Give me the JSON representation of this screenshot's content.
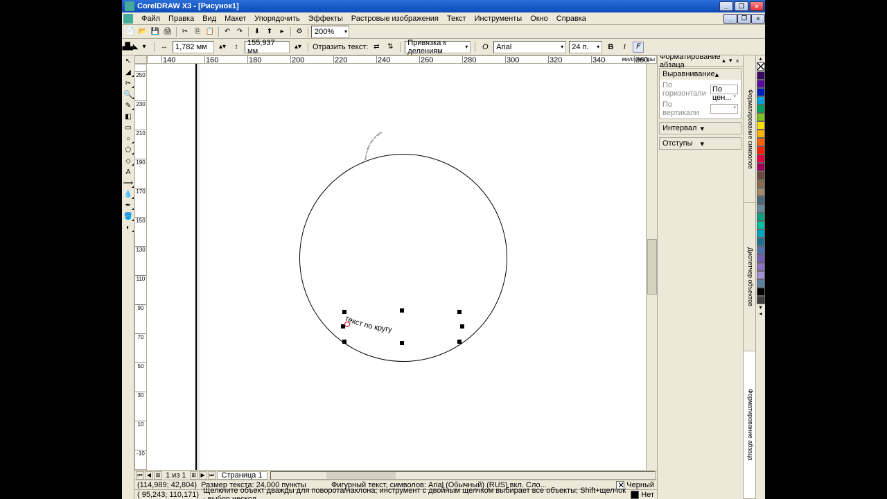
{
  "title": "CorelDRAW X3 - [Рисунок1]",
  "menus": [
    "Файл",
    "Правка",
    "Вид",
    "Макет",
    "Упорядочить",
    "Эффекты",
    "Растровые изображения",
    "Текст",
    "Инструменты",
    "Окно",
    "Справка"
  ],
  "zoom": "200%",
  "propbar": {
    "dist1": "1,782 мм",
    "dist2": "155,937 мм",
    "mirror": "Отразить текст:",
    "snap": "Привязка к делениям",
    "font": "Arial",
    "size": "24 п."
  },
  "ruler_units": "миллиметры",
  "ruler_h": [
    140,
    160,
    180,
    200,
    220,
    240,
    260,
    280,
    300,
    320,
    340,
    360
  ],
  "ruler_v_start": 250,
  "ruler_v_step": 20,
  "docker": {
    "title": "Форматирование абзаца",
    "sections": {
      "align": "Выравнивание",
      "horiz": "По горизонтали",
      "horiz_val": "По цен...",
      "vert": "По вертикали",
      "interval": "Интервал",
      "indents": "Отступы"
    }
  },
  "docker_tabs": [
    "Форматирование символов",
    "Диспетчер объектов",
    "Форматирование абзаца"
  ],
  "palette_colors": [
    "#3a0a5e",
    "#5a0a9e",
    "#0020c0",
    "#00a0e0",
    "#00a060",
    "#80c020",
    "#ffe000",
    "#ffb000",
    "#ff6000",
    "#ff2000",
    "#e00040",
    "#a0005a",
    "#6a4a3a",
    "#8a6a4a",
    "#a08a6a",
    "#4a6a7a",
    "#6a8a9a",
    "#0aa080",
    "#00c0a0",
    "#00a0c0",
    "#207090",
    "#5070b0",
    "#7060b0",
    "#9070c0",
    "#a090d0",
    "#6080a0",
    "#000000",
    "#404040"
  ],
  "page_nav": {
    "counter": "1 из 1",
    "tab": "Страница 1"
  },
  "status": {
    "coord": "(114,989; 42,804)",
    "size": "Размер текста: 24,000 пункты",
    "obj": "Фигурный текст, символов: Arial (Обычный) (RUS) вкл. Сло...",
    "coord2": "( 95,243; 110,171)",
    "hint": "Щелкните объект дважды для поворота/наклона; инструмент с двойным щелчком выбирает все объекты; Shift+щелчок - выбор нескол...",
    "fill": "Черный",
    "outline": "Нет"
  },
  "canvas": {
    "top_text": "Текст по кругу текст по кругу",
    "bottom_text": "текст по кругу"
  }
}
